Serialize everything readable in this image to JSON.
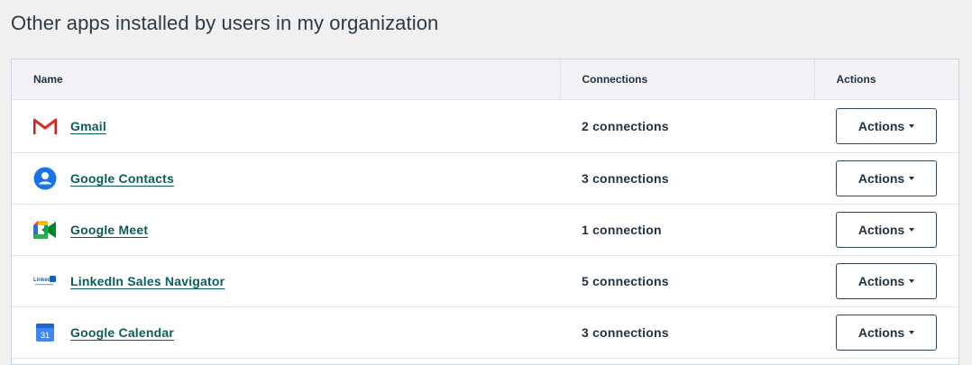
{
  "page": {
    "title": "Other apps installed by users in my organization"
  },
  "table": {
    "headers": {
      "name": "Name",
      "connections": "Connections",
      "actions": "Actions"
    },
    "rows": [
      {
        "name": "Gmail",
        "icon": "gmail-icon",
        "connections": "2 connections",
        "action_label": "Actions"
      },
      {
        "name": "Google Contacts",
        "icon": "google-contacts-icon",
        "connections": "3 connections",
        "action_label": "Actions"
      },
      {
        "name": "Google Meet",
        "icon": "google-meet-icon",
        "connections": "1 connection",
        "action_label": "Actions"
      },
      {
        "name": "LinkedIn Sales Navigator",
        "icon": "linkedin-sales-navigator-icon",
        "connections": "5 connections",
        "action_label": "Actions"
      },
      {
        "name": "Google Calendar",
        "icon": "google-calendar-icon",
        "connections": "3 connections",
        "action_label": "Actions"
      }
    ]
  },
  "icon_labels": {
    "calendar_day": "31",
    "linkedin_wordmark": "Linked"
  },
  "colors": {
    "link": "#0b5c5a",
    "header_bg": "#f5f2f7",
    "page_bg": "#f0f0f0"
  }
}
